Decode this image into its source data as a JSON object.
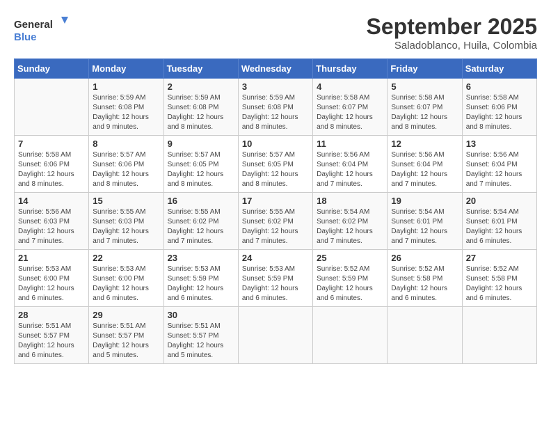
{
  "logo": {
    "line1": "General",
    "line2": "Blue"
  },
  "title": "September 2025",
  "subtitle": "Saladoblanco, Huila, Colombia",
  "days_header": [
    "Sunday",
    "Monday",
    "Tuesday",
    "Wednesday",
    "Thursday",
    "Friday",
    "Saturday"
  ],
  "weeks": [
    [
      {
        "num": "",
        "info": ""
      },
      {
        "num": "1",
        "info": "Sunrise: 5:59 AM\nSunset: 6:08 PM\nDaylight: 12 hours\nand 9 minutes."
      },
      {
        "num": "2",
        "info": "Sunrise: 5:59 AM\nSunset: 6:08 PM\nDaylight: 12 hours\nand 8 minutes."
      },
      {
        "num": "3",
        "info": "Sunrise: 5:59 AM\nSunset: 6:08 PM\nDaylight: 12 hours\nand 8 minutes."
      },
      {
        "num": "4",
        "info": "Sunrise: 5:58 AM\nSunset: 6:07 PM\nDaylight: 12 hours\nand 8 minutes."
      },
      {
        "num": "5",
        "info": "Sunrise: 5:58 AM\nSunset: 6:07 PM\nDaylight: 12 hours\nand 8 minutes."
      },
      {
        "num": "6",
        "info": "Sunrise: 5:58 AM\nSunset: 6:06 PM\nDaylight: 12 hours\nand 8 minutes."
      }
    ],
    [
      {
        "num": "7",
        "info": "Sunrise: 5:58 AM\nSunset: 6:06 PM\nDaylight: 12 hours\nand 8 minutes."
      },
      {
        "num": "8",
        "info": "Sunrise: 5:57 AM\nSunset: 6:06 PM\nDaylight: 12 hours\nand 8 minutes."
      },
      {
        "num": "9",
        "info": "Sunrise: 5:57 AM\nSunset: 6:05 PM\nDaylight: 12 hours\nand 8 minutes."
      },
      {
        "num": "10",
        "info": "Sunrise: 5:57 AM\nSunset: 6:05 PM\nDaylight: 12 hours\nand 8 minutes."
      },
      {
        "num": "11",
        "info": "Sunrise: 5:56 AM\nSunset: 6:04 PM\nDaylight: 12 hours\nand 7 minutes."
      },
      {
        "num": "12",
        "info": "Sunrise: 5:56 AM\nSunset: 6:04 PM\nDaylight: 12 hours\nand 7 minutes."
      },
      {
        "num": "13",
        "info": "Sunrise: 5:56 AM\nSunset: 6:04 PM\nDaylight: 12 hours\nand 7 minutes."
      }
    ],
    [
      {
        "num": "14",
        "info": "Sunrise: 5:56 AM\nSunset: 6:03 PM\nDaylight: 12 hours\nand 7 minutes."
      },
      {
        "num": "15",
        "info": "Sunrise: 5:55 AM\nSunset: 6:03 PM\nDaylight: 12 hours\nand 7 minutes."
      },
      {
        "num": "16",
        "info": "Sunrise: 5:55 AM\nSunset: 6:02 PM\nDaylight: 12 hours\nand 7 minutes."
      },
      {
        "num": "17",
        "info": "Sunrise: 5:55 AM\nSunset: 6:02 PM\nDaylight: 12 hours\nand 7 minutes."
      },
      {
        "num": "18",
        "info": "Sunrise: 5:54 AM\nSunset: 6:02 PM\nDaylight: 12 hours\nand 7 minutes."
      },
      {
        "num": "19",
        "info": "Sunrise: 5:54 AM\nSunset: 6:01 PM\nDaylight: 12 hours\nand 7 minutes."
      },
      {
        "num": "20",
        "info": "Sunrise: 5:54 AM\nSunset: 6:01 PM\nDaylight: 12 hours\nand 6 minutes."
      }
    ],
    [
      {
        "num": "21",
        "info": "Sunrise: 5:53 AM\nSunset: 6:00 PM\nDaylight: 12 hours\nand 6 minutes."
      },
      {
        "num": "22",
        "info": "Sunrise: 5:53 AM\nSunset: 6:00 PM\nDaylight: 12 hours\nand 6 minutes."
      },
      {
        "num": "23",
        "info": "Sunrise: 5:53 AM\nSunset: 5:59 PM\nDaylight: 12 hours\nand 6 minutes."
      },
      {
        "num": "24",
        "info": "Sunrise: 5:53 AM\nSunset: 5:59 PM\nDaylight: 12 hours\nand 6 minutes."
      },
      {
        "num": "25",
        "info": "Sunrise: 5:52 AM\nSunset: 5:59 PM\nDaylight: 12 hours\nand 6 minutes."
      },
      {
        "num": "26",
        "info": "Sunrise: 5:52 AM\nSunset: 5:58 PM\nDaylight: 12 hours\nand 6 minutes."
      },
      {
        "num": "27",
        "info": "Sunrise: 5:52 AM\nSunset: 5:58 PM\nDaylight: 12 hours\nand 6 minutes."
      }
    ],
    [
      {
        "num": "28",
        "info": "Sunrise: 5:51 AM\nSunset: 5:57 PM\nDaylight: 12 hours\nand 6 minutes."
      },
      {
        "num": "29",
        "info": "Sunrise: 5:51 AM\nSunset: 5:57 PM\nDaylight: 12 hours\nand 5 minutes."
      },
      {
        "num": "30",
        "info": "Sunrise: 5:51 AM\nSunset: 5:57 PM\nDaylight: 12 hours\nand 5 minutes."
      },
      {
        "num": "",
        "info": ""
      },
      {
        "num": "",
        "info": ""
      },
      {
        "num": "",
        "info": ""
      },
      {
        "num": "",
        "info": ""
      }
    ]
  ]
}
